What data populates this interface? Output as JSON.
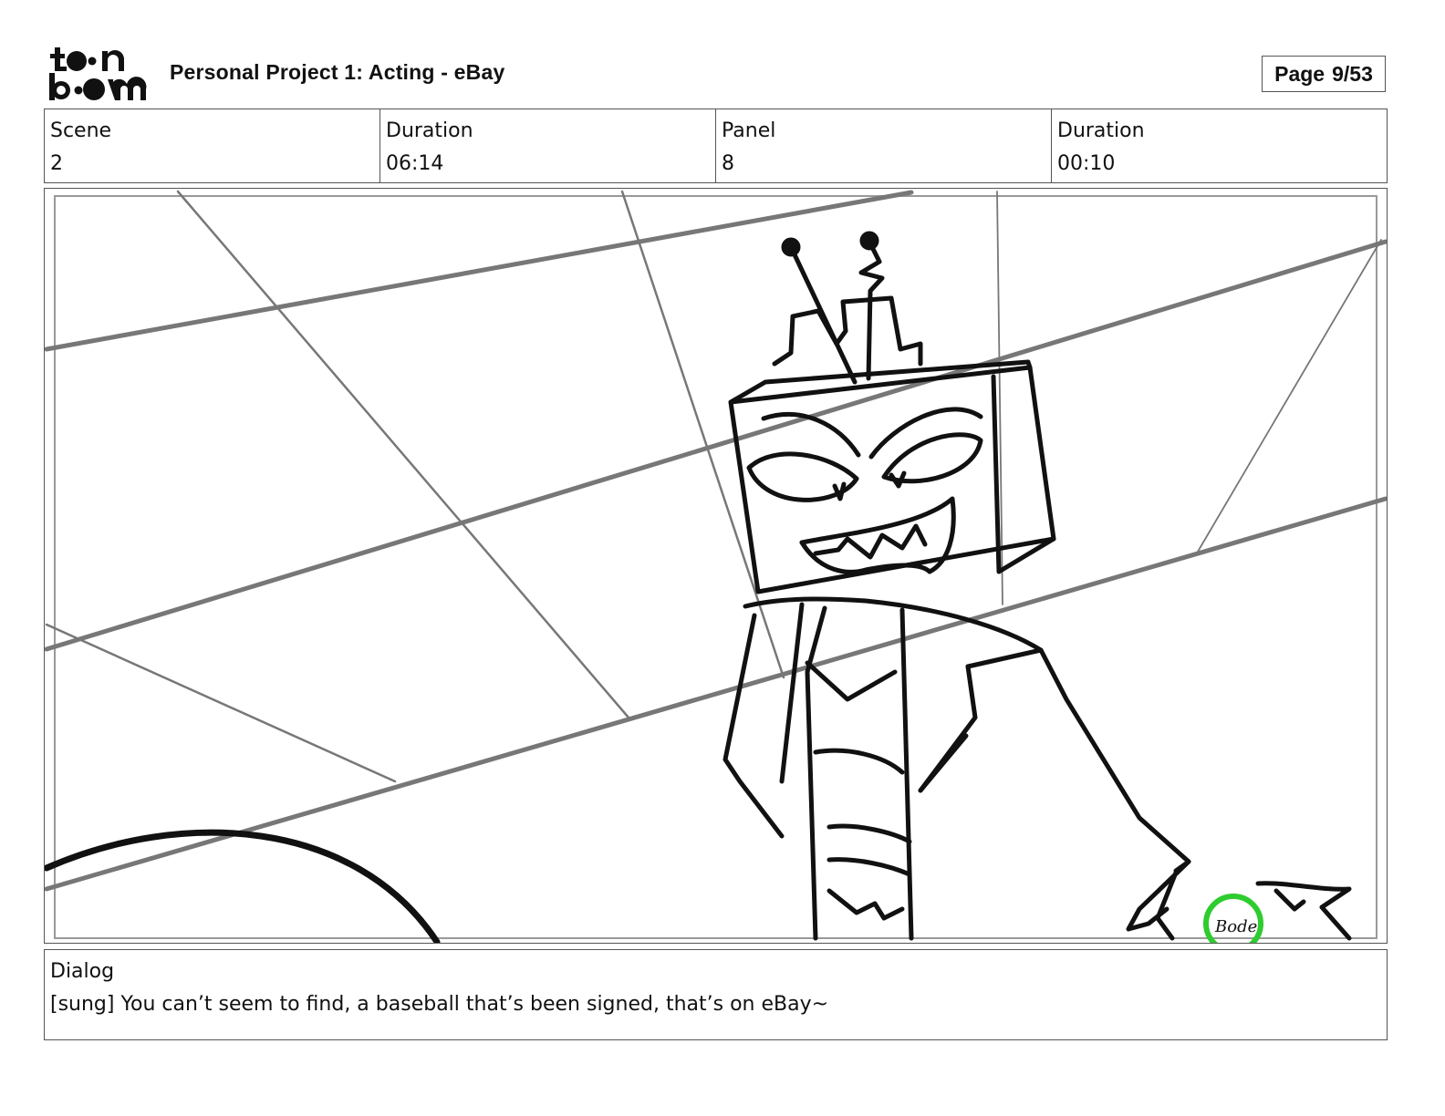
{
  "header": {
    "logo_text": "toonboom",
    "title": "Personal Project 1: Acting - eBay",
    "page_label": "Page",
    "page_value": "9/53"
  },
  "info": {
    "scene_label": "Scene",
    "scene_value": "2",
    "scene_duration_label": "Duration",
    "scene_duration_value": "06:14",
    "panel_label": "Panel",
    "panel_value": "8",
    "panel_duration_label": "Duration",
    "panel_duration_value": "00:10"
  },
  "dialog": {
    "label": "Dialog",
    "text": "[sung] You can’t seem to find, a baseball that’s been signed, that’s on eBay~"
  },
  "panel": {
    "signature_text": "Bode",
    "signature_color": "#2ecc2e"
  }
}
